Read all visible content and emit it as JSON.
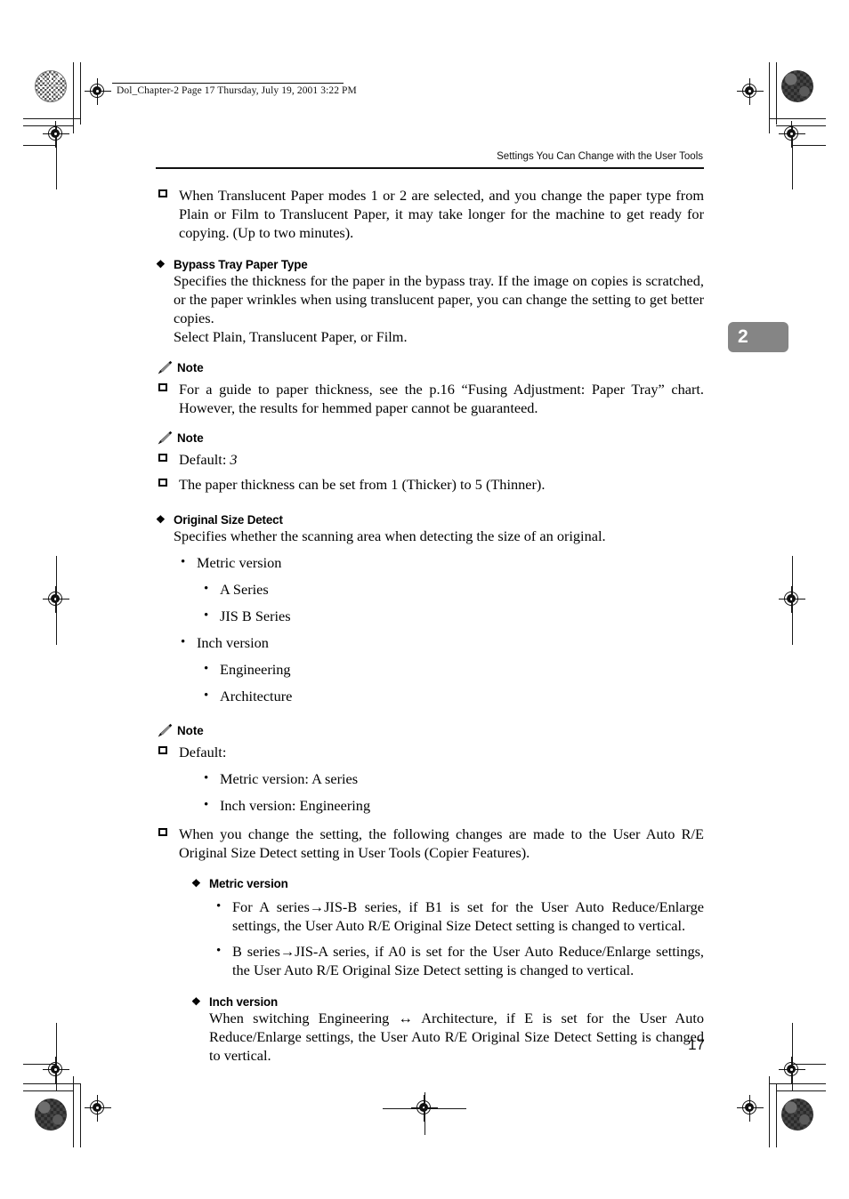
{
  "print_slug": "Dol_Chapter-2  Page 17  Thursday, July 19, 2001  3:22 PM",
  "running_head": "Settings You Can Change with the User Tools",
  "chapter_tab": "2",
  "page_number": "17",
  "glyphs": {
    "diamond_bullet": "❖",
    "round_bullet": "•"
  },
  "intro_item": "When Translucent Paper modes 1 or 2 are selected, and you change the paper type from Plain or Film to Translucent Paper, it may take longer for the machine to get ready for copying. (Up to two minutes).",
  "sections": {
    "bypass_tray": {
      "heading": "Bypass Tray Paper Type",
      "body": "Specifies the thickness for the paper in the bypass tray. If the image on copies is scratched, or the paper wrinkles when using translucent paper, you can change the setting to get better copies.",
      "body_line2": "Select Plain, Translucent Paper, or Film.",
      "note1": {
        "label": "Note",
        "item": "For a guide to paper thickness, see the p.16 “Fusing Adjustment: Paper Tray” chart. However, the results for hemmed paper cannot be guaranteed."
      },
      "note2": {
        "label": "Note",
        "item1_prefix": "Default: ",
        "item1_value": "3",
        "item2": "The paper thickness can be set from 1 (Thicker) to 5 (Thinner)."
      }
    },
    "original_size_detect": {
      "heading": "Original Size Detect",
      "body": "Specifies whether the scanning area when detecting the size of an original.",
      "options": [
        {
          "label": "Metric version",
          "level": 1
        },
        {
          "label": "A Series",
          "level": 2
        },
        {
          "label": "JIS B Series",
          "level": 2
        },
        {
          "label": "Inch version",
          "level": 1
        },
        {
          "label": "Engineering",
          "level": 2
        },
        {
          "label": "Architecture",
          "level": 2
        }
      ],
      "note": {
        "label": "Note",
        "default_label": "Default:",
        "defaults": [
          "Metric version: A series",
          "Inch version: Engineering"
        ],
        "change_item": "When you change the setting, the following changes are made to the User Auto R/E Original Size Detect setting in User Tools (Copier Features).",
        "metric": {
          "heading": "Metric version",
          "bullets": [
            "For A series→JIS-B series, if B1 is set for the User Auto Reduce/Enlarge settings, the User Auto R/E Original Size Detect setting is changed to vertical.",
            "B series→JIS-A series, if A0 is set for the User Auto Reduce/Enlarge settings, the User Auto R/E Original Size Detect setting is changed to vertical."
          ]
        },
        "inch": {
          "heading": "Inch version",
          "body": "When switching Engineering ↔ Architecture, if E is set for the User Auto Reduce/Enlarge settings, the User Auto R/E Original Size Detect Setting is changed to vertical."
        }
      }
    }
  }
}
